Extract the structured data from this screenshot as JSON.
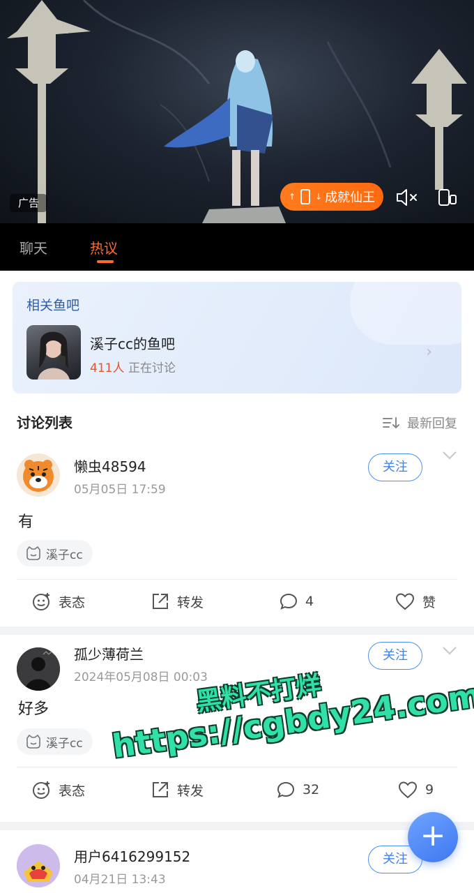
{
  "banner": {
    "ad_label": "广告",
    "promo_label": "成就仙王",
    "icons": [
      "mute-icon",
      "rotate-screen-icon",
      "phone-icon"
    ]
  },
  "tabs": [
    {
      "label": "聊天",
      "active": false
    },
    {
      "label": "热议",
      "active": true
    }
  ],
  "accent_color": "#ff6b2b",
  "related": {
    "title": "相关鱼吧",
    "name": "溪子cc的鱼吧",
    "count": "411人",
    "status": "正在讨论"
  },
  "discussion": {
    "title": "讨论列表",
    "sort_label": "最新回复"
  },
  "posts": [
    {
      "username": "懒虫48594",
      "time": "05月05日 17:59",
      "follow_label": "关注",
      "body": "有",
      "tag": "溪子cc",
      "actions": {
        "react": "表态",
        "share": "转发",
        "comments": "4",
        "like": "赞"
      }
    },
    {
      "username": "孤少薄荷兰",
      "time": "2024年05月08日 00:03",
      "follow_label": "关注",
      "body": "好多",
      "tag": "溪子cc",
      "actions": {
        "react": "表态",
        "share": "转发",
        "comments": "32",
        "like": "9"
      }
    },
    {
      "username": "用户6416299152",
      "time": "04月21日 13:43",
      "follow_label": "关注"
    }
  ],
  "fab_label": "+",
  "watermark": {
    "line1": "黑料不打烊",
    "line2": "https://cgbdy24.com"
  }
}
